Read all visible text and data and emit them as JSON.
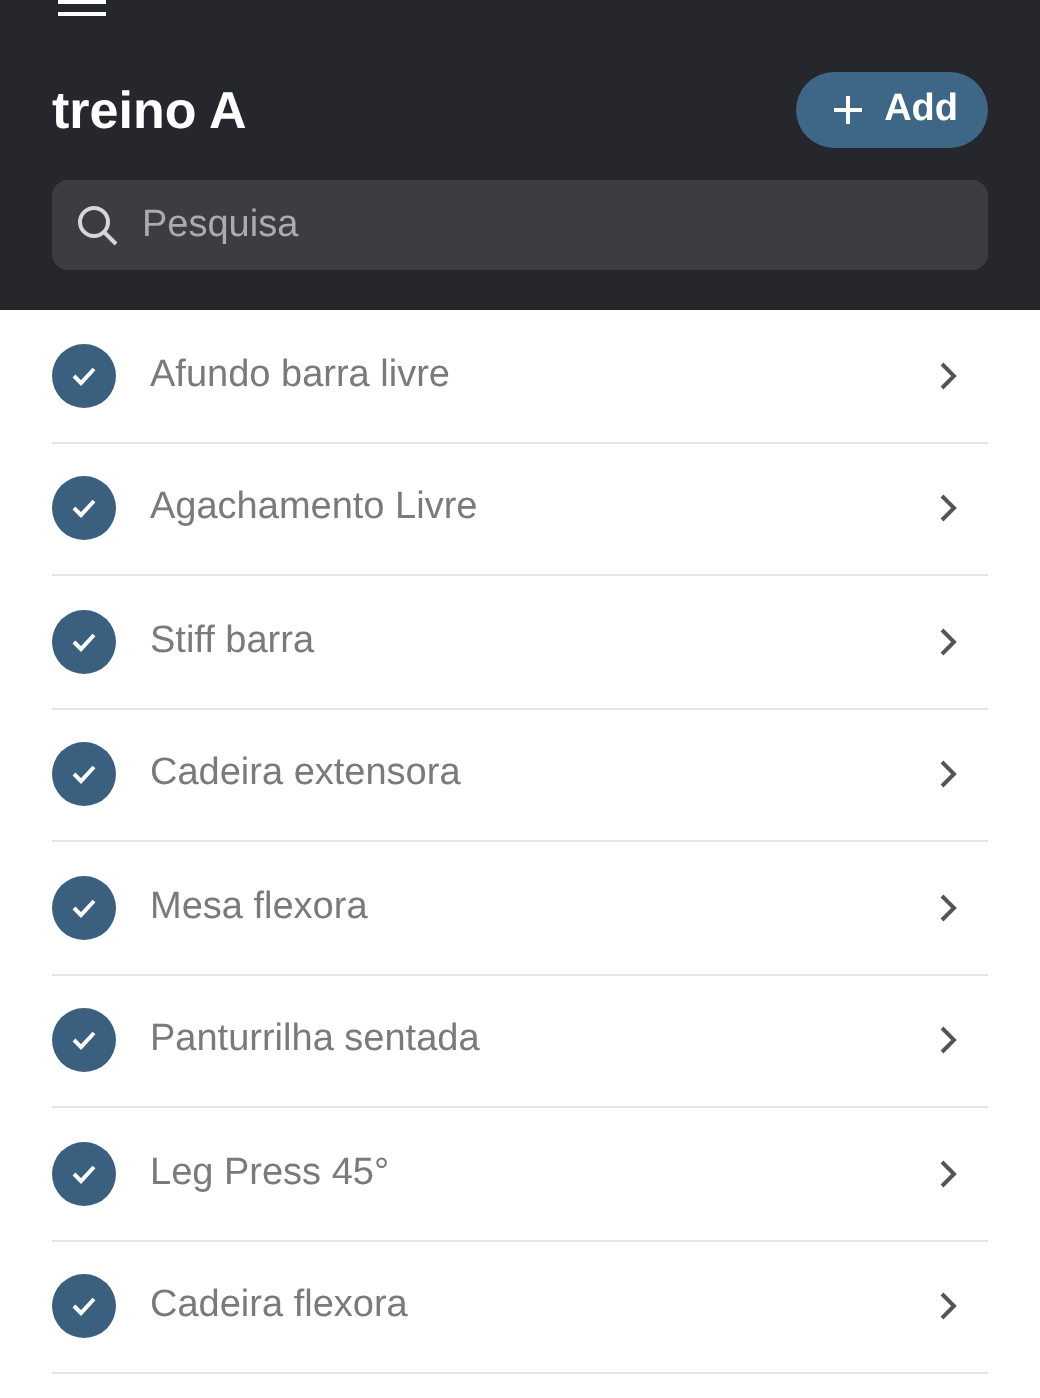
{
  "header": {
    "title": "treino A",
    "add_button": "Add",
    "search": {
      "placeholder": "Pesquisa"
    }
  },
  "exercises": [
    {
      "name": "Afundo barra livre",
      "checked": true
    },
    {
      "name": "Agachamento Livre",
      "checked": true
    },
    {
      "name": "Stiff barra",
      "checked": true
    },
    {
      "name": "Cadeira extensora",
      "checked": true
    },
    {
      "name": "Mesa flexora",
      "checked": true
    },
    {
      "name": "Panturrilha sentada",
      "checked": true
    },
    {
      "name": "Leg Press 45°",
      "checked": true
    },
    {
      "name": "Cadeira flexora",
      "checked": true
    }
  ]
}
